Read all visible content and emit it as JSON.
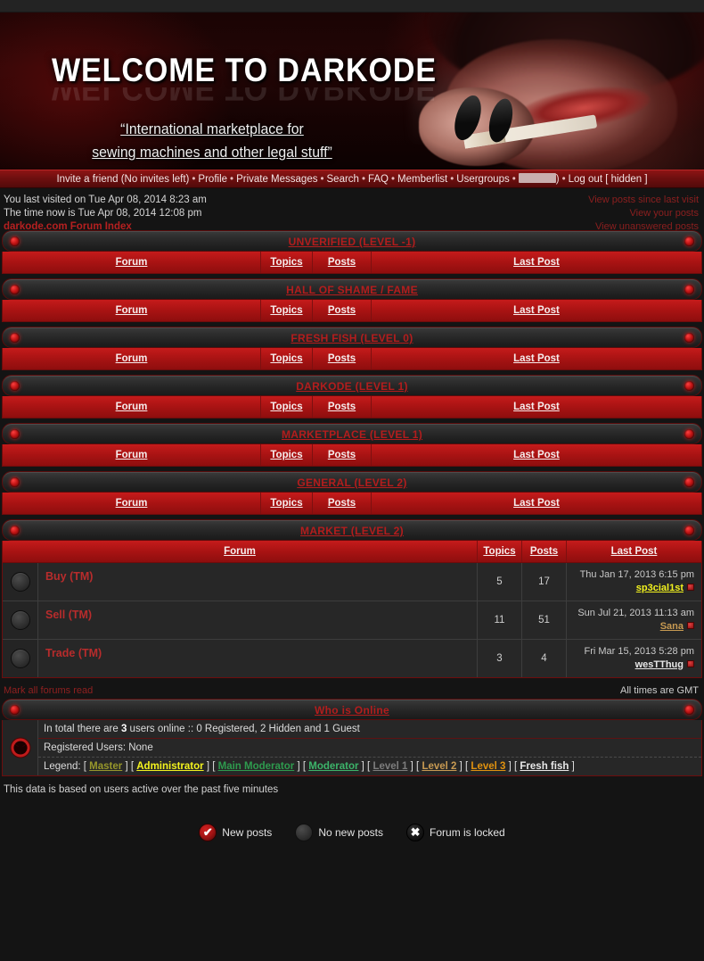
{
  "banner": {
    "welcome": "WELCOME TO DARKODE",
    "tagline_line1": "“International marketplace for",
    "tagline_line2": "sewing machines and other legal stuff”"
  },
  "nav": {
    "items": [
      "Invite a friend (No invites left)",
      "Profile",
      "Private Messages",
      "Search",
      "FAQ",
      "Memberlist",
      "Usergroups"
    ],
    "username_redacted": true,
    "username_suffix": ")",
    "logout": "Log out [ hidden ]"
  },
  "info": {
    "last_visited": "You last visited on Tue Apr 08, 2014 8:23 am",
    "time_now": "The time now is Tue Apr 08, 2014 12:08 pm",
    "breadcrumb": "darkode.com Forum Index",
    "links": [
      "View posts since last visit",
      "View your posts",
      "View unanswered posts"
    ]
  },
  "columns": {
    "forum": "Forum",
    "topics": "Topics",
    "posts": "Posts",
    "last_post": "Last Post"
  },
  "categories": [
    {
      "title": "UNVERIFIED (LEVEL -1)",
      "forums": []
    },
    {
      "title": "HALL OF SHAME / FAME",
      "forums": []
    },
    {
      "title": "FRESH FISH (LEVEL 0)",
      "forums": []
    },
    {
      "title": "DARKODE (LEVEL 1)",
      "forums": []
    },
    {
      "title": "MARKETPLACE (LEVEL 1)",
      "forums": []
    },
    {
      "title": "GENERAL (LEVEL 2)",
      "forums": []
    },
    {
      "title": "MARKET (LEVEL 2)",
      "forums": [
        {
          "name": "Buy (TM)",
          "topics": "5",
          "posts": "17",
          "last_post_date": "Thu Jan 17, 2013 6:15 pm",
          "last_post_user": "sp3cial1st",
          "last_post_user_color": "#f3f31e"
        },
        {
          "name": "Sell (TM)",
          "topics": "11",
          "posts": "51",
          "last_post_date": "Sun Jul 21, 2013 11:13 am",
          "last_post_user": "Sana",
          "last_post_user_color": "#c79a52"
        },
        {
          "name": "Trade (TM)",
          "topics": "3",
          "posts": "4",
          "last_post_date": "Fri Mar 15, 2013 5:28 pm",
          "last_post_user": "wesTThug",
          "last_post_user_color": "#e8e8e8"
        }
      ]
    }
  ],
  "under_table": {
    "mark_read": "Mark all forums read",
    "timezone": "All times are GMT"
  },
  "who_is_online": {
    "title": "Who is Online",
    "total_pre": "In total there are ",
    "total_count": "3",
    "total_post": " users online :: 0 Registered, 2 Hidden and 1 Guest",
    "registered_users": "Registered Users: None",
    "legend_label": "Legend:",
    "legend": [
      {
        "label": "Master",
        "color": "#97972b"
      },
      {
        "label": "Administrator",
        "color": "#f3f31e"
      },
      {
        "label": "Main Moderator",
        "color": "#2e9b4e"
      },
      {
        "label": "Moderator",
        "color": "#3cb46a"
      },
      {
        "label": "Level 1",
        "color": "#7d7d7d"
      },
      {
        "label": "Level 2",
        "color": "#c79a52"
      },
      {
        "label": "Level 3",
        "color": "#e0920f"
      },
      {
        "label": "Fresh fish",
        "color": "#e8e8e8"
      }
    ],
    "five_minutes": "This data is based on users active over the past five minutes"
  },
  "footer_legend": [
    {
      "label": "New posts",
      "icon": "check-icon",
      "glyph": "✔"
    },
    {
      "label": "No new posts",
      "icon": "circle-icon",
      "glyph": ""
    },
    {
      "label": "Forum is locked",
      "icon": "cross-icon",
      "glyph": "✖"
    }
  ]
}
